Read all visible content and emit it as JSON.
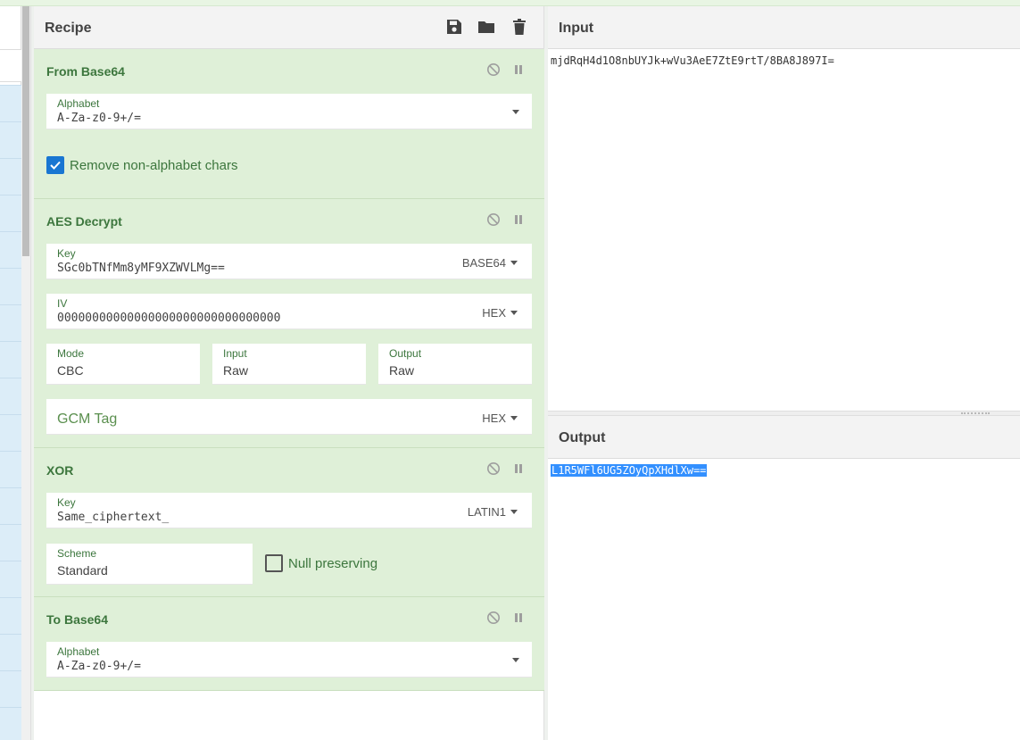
{
  "recipe": {
    "title": "Recipe",
    "header_icons": [
      "save-icon",
      "folder-icon",
      "trash-icon"
    ],
    "operations": [
      {
        "name": "From Base64",
        "alphabet_label": "Alphabet",
        "alphabet_value": "A-Za-z0-9+/=",
        "checkbox_label": "Remove non-alphabet chars",
        "checkbox_checked": true
      },
      {
        "name": "AES Decrypt",
        "key_label": "Key",
        "key_value": "SGc0bTNfMm8yMF9XZWVLMg==",
        "key_format": "BASE64",
        "iv_label": "IV",
        "iv_value": "00000000000000000000000000000000",
        "iv_format": "HEX",
        "mode_label": "Mode",
        "mode_value": "CBC",
        "input_label": "Input",
        "input_value": "Raw",
        "output_label": "Output",
        "output_value": "Raw",
        "gcm_placeholder": "GCM Tag",
        "gcm_format": "HEX"
      },
      {
        "name": "XOR",
        "key_label": "Key",
        "key_value": "Same_ciphertext_",
        "key_format": "LATIN1",
        "scheme_label": "Scheme",
        "scheme_value": "Standard",
        "null_label": "Null preserving",
        "null_checked": false
      },
      {
        "name": "To Base64",
        "alphabet_label": "Alphabet",
        "alphabet_value": "A-Za-z0-9+/="
      }
    ]
  },
  "input": {
    "title": "Input",
    "text": "mjdRqH4d1O8nbUYJk+wVu3AeE7ZtE9rtT/8BA8J897I="
  },
  "output": {
    "title": "Output",
    "text": "L1R5WFl6UG5ZOyQpXHdlXw=="
  },
  "colors": {
    "op_background": "#dff0d8",
    "op_title": "#3c763d",
    "checkbox_blue": "#1976d2",
    "selection_blue": "#3390ff",
    "ops_list_blue": "#dcedf8"
  }
}
